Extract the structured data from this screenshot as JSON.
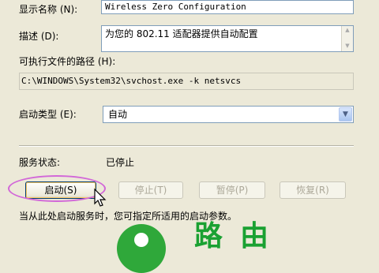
{
  "labels": {
    "display_name": "显示名称 (N):",
    "description": "描述 (D):",
    "exe_path": "可执行文件的路径 (H):",
    "startup_type": "启动类型 (E):",
    "service_status": "服务状态:"
  },
  "values": {
    "display_name": "Wireless Zero Configuration",
    "description": "为您的 802.11 适配器提供自动配置",
    "exe_path": "C:\\WINDOWS\\System32\\svchost.exe -k netsvcs",
    "startup_type": "自动",
    "service_status": "已停止"
  },
  "buttons": {
    "start": "启动(S)",
    "stop": "停止(T)",
    "pause": "暂停(P)",
    "resume": "恢复(R)"
  },
  "hint": "当从此处启动服务时，您可指定所适用的启动参数。",
  "watermark": "路由"
}
